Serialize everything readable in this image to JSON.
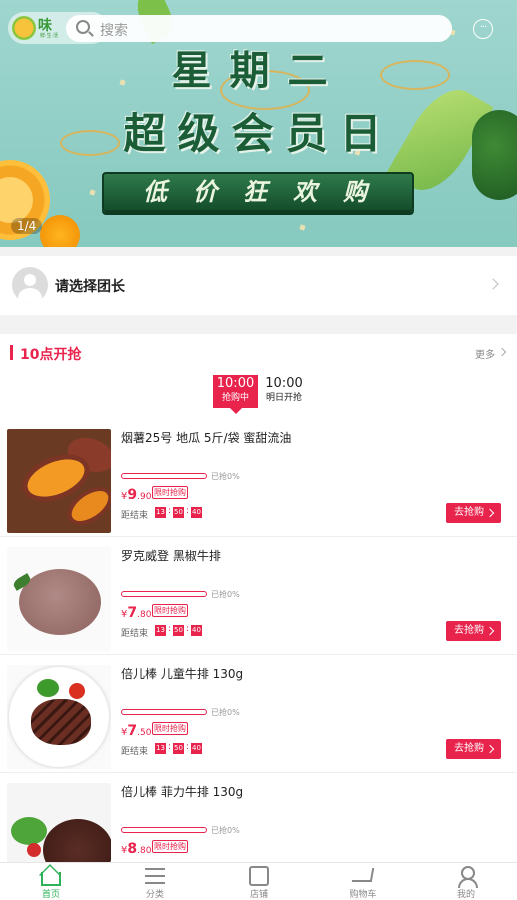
{
  "app": {
    "logo_text": "味",
    "logo_sub": "鲜·生·活"
  },
  "header": {
    "search_placeholder": "搜索"
  },
  "banner": {
    "line1": "星期二",
    "line2": "超级会员日",
    "line3": "低价狂欢购",
    "pager": "1/4"
  },
  "leader": {
    "label": "请选择团长"
  },
  "flash_sale": {
    "title": "10点开抢",
    "more": "更多",
    "tabs": [
      {
        "time": "10:00",
        "status": "抢购中",
        "active": true
      },
      {
        "time": "10:00",
        "status": "明日开抢",
        "active": false
      }
    ],
    "products": [
      {
        "name": "烟薯25号 地瓜 5斤/袋 蜜甜流油",
        "sold": "已抢0%",
        "sold_fraction": 0,
        "currency": "¥",
        "price_int": "9",
        "price_dec": ".90",
        "badge": "限时抢购",
        "ends_label": "距结束",
        "h": "13",
        "m": "50",
        "s": "40",
        "button": "去抢购"
      },
      {
        "name": "罗克威登 黑椒牛排",
        "sold": "已抢0%",
        "sold_fraction": 0,
        "currency": "¥",
        "price_int": "7",
        "price_dec": ".80",
        "badge": "限时抢购",
        "ends_label": "距结束",
        "h": "13",
        "m": "50",
        "s": "40",
        "button": "去抢购"
      },
      {
        "name": "倍儿棒 儿童牛排 130g",
        "sold": "已抢0%",
        "sold_fraction": 0,
        "currency": "¥",
        "price_int": "7",
        "price_dec": ".50",
        "badge": "限时抢购",
        "ends_label": "距结束",
        "h": "13",
        "m": "50",
        "s": "40",
        "button": "去抢购"
      },
      {
        "name": "倍儿棒 菲力牛排 130g",
        "sold": "已抢0%",
        "sold_fraction": 0,
        "currency": "¥",
        "price_int": "8",
        "price_dec": ".80",
        "badge": "限时抢购"
      }
    ]
  },
  "nav": {
    "items": [
      {
        "label": "首页",
        "icon": "home-icon",
        "active": true
      },
      {
        "label": "分类",
        "icon": "list-icon"
      },
      {
        "label": "店铺",
        "icon": "store-icon"
      },
      {
        "label": "购物车",
        "icon": "cart-icon"
      },
      {
        "label": "我的",
        "icon": "user-icon"
      }
    ]
  },
  "colors": {
    "accent": "#e8234c",
    "nav_active": "#2fb15a"
  }
}
